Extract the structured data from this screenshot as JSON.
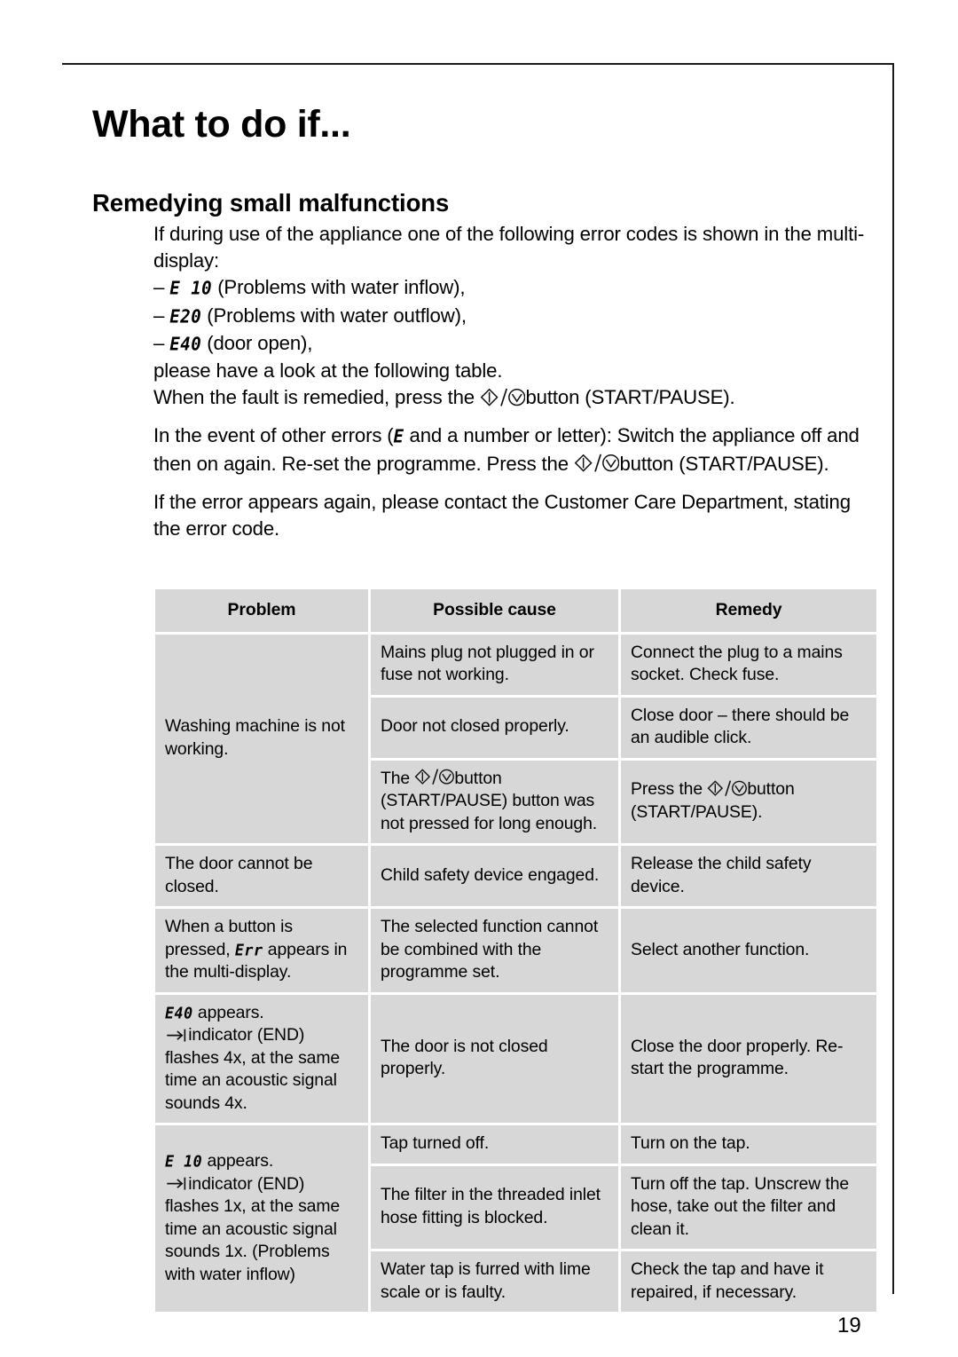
{
  "page": {
    "title": "What to do if...",
    "section_title": "Remedying small malfunctions",
    "folio": "19"
  },
  "icons": {
    "start_pause": "start-pause-icon",
    "end_indicator": "end-arrow-icon"
  },
  "intro": {
    "line1": "If during use of the appliance one of the following error codes is shown in the multi-display:",
    "bullets": [
      {
        "dash": "–",
        "code": "E 10",
        "text": "(Problems with water inflow),"
      },
      {
        "dash": "–",
        "code": "E20",
        "text": "(Problems with water outflow),"
      },
      {
        "dash": "–",
        "code": "E40",
        "text": "(door open),"
      }
    ],
    "line2": "please have a look at the following table.",
    "line3_before": "When the fault is remedied, press the",
    "line3_after": "button (START/PAUSE).",
    "para2_a": "In the event of other errors (",
    "para2_code": "E",
    "para2_b": " and a number or letter): Switch the appliance off and then on again. Re-set the programme. Press the",
    "para2_c": "button (START/PAUSE).",
    "para3": "If the error appears again, please contact the Customer Care Department, stating the error code."
  },
  "table": {
    "headers": [
      "Problem",
      "Possible cause",
      "Remedy"
    ],
    "rows": [
      {
        "problem": "Washing machine is not working.",
        "problem_rowspan": 3,
        "entries": [
          {
            "cause": "Mains plug not plugged in or fuse not working.",
            "remedy": "Connect the plug to a mains socket. Check fuse."
          },
          {
            "cause": "Door not closed properly.",
            "remedy": "Close door – there should be an audible click."
          },
          {
            "cause_before": "The",
            "cause_icon": "start-pause-icon",
            "cause_after": "button (START/PAUSE) button was not pressed for long enough.",
            "remedy_before": "Press the",
            "remedy_icon": "start-pause-icon",
            "remedy_after": "button (START/PAUSE)."
          }
        ]
      },
      {
        "problem": "The door cannot be closed.",
        "problem_rowspan": 1,
        "entries": [
          {
            "cause": "Child safety device engaged.",
            "remedy": "Release the child safety device."
          }
        ]
      },
      {
        "problem_before": "When a button is pressed,",
        "problem_code": "Err",
        "problem_after": "appears in the multi-display.",
        "problem_rowspan": 1,
        "entries": [
          {
            "cause": "The selected function cannot be combined with the programme set.",
            "remedy": "Select another function."
          }
        ]
      },
      {
        "problem_code": "E40",
        "problem_line1_after": "appears.",
        "problem_icon": "end-arrow-icon",
        "problem_line2": "indicator (END) flashes 4x, at the same time an acoustic signal sounds 4x.",
        "problem_rowspan": 1,
        "entries": [
          {
            "cause": "The door is not closed properly.",
            "remedy": "Close the door properly. Re-start the programme."
          }
        ]
      },
      {
        "problem_code": "E 10",
        "problem_line1_after": "appears.",
        "problem_icon": "end-arrow-icon",
        "problem_line2": "indicator (END) flashes 1x, at the same time an acoustic signal sounds 1x.",
        "problem_line3": "(Problems with water inflow)",
        "problem_rowspan": 3,
        "entries": [
          {
            "cause": "Tap turned off.",
            "remedy": "Turn on the tap."
          },
          {
            "cause": "The filter in the threaded inlet hose fitting is blocked.",
            "remedy": "Turn off the tap. Unscrew the hose, take out the filter and clean it."
          },
          {
            "cause": "Water tap is furred with lime scale or is faulty.",
            "remedy": "Check the tap and have it repaired, if necessary."
          }
        ]
      }
    ]
  },
  "colors": {
    "cell_background": "#d7d7d7",
    "rule": "#1a1a1a",
    "text": "#000000"
  }
}
